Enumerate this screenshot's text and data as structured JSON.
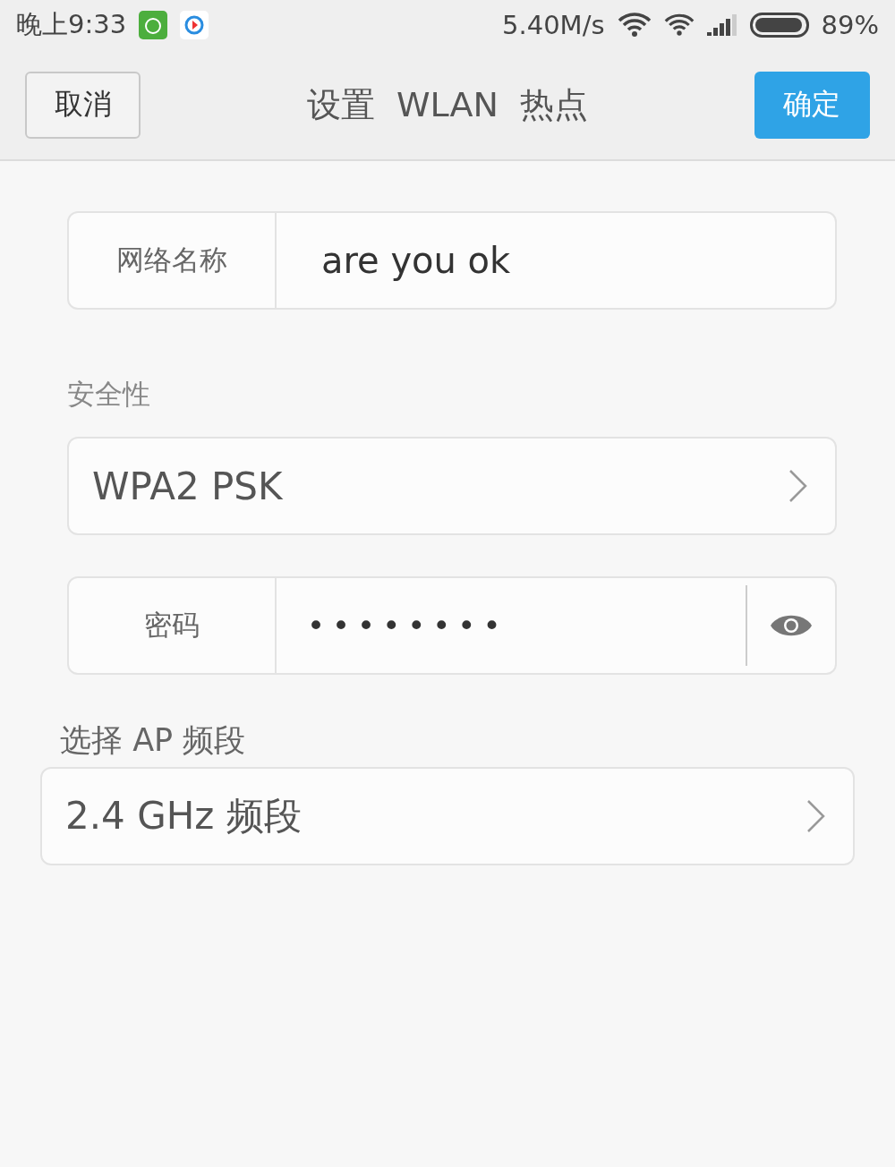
{
  "status_bar": {
    "time": "晚上9:33",
    "speed": "5.40M/s",
    "battery": "89%"
  },
  "header": {
    "cancel": "取消",
    "title": "设置  WLAN  热点",
    "confirm": "确定"
  },
  "network_name": {
    "label": "网络名称",
    "value": "are you ok"
  },
  "security": {
    "label": "安全性",
    "value": "WPA2 PSK"
  },
  "password": {
    "label": "密码",
    "value": "••••••••"
  },
  "band": {
    "label": "选择 AP 频段",
    "value": "2.4 GHz 频段"
  }
}
